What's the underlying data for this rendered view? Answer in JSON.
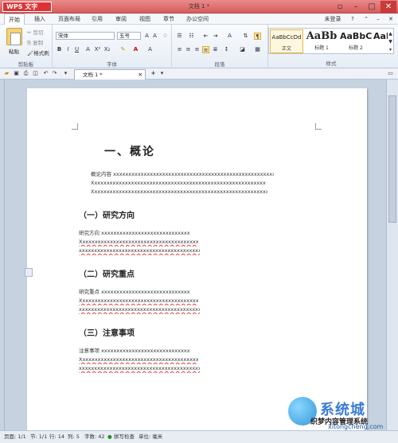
{
  "titlebar": {
    "app_button": "WPS 文字",
    "doc_title": "文档 1 *"
  },
  "menu": [
    "开始",
    "插入",
    "页面布局",
    "引用",
    "审阅",
    "视图",
    "章节",
    "办公空间"
  ],
  "menu_right": "未登录",
  "ribbon": {
    "paste_label": "粘贴",
    "cut_label": "剪切",
    "copy_label": "复制",
    "format_painter_label": "格式刷",
    "font_name": "宋体",
    "font_size": "五号",
    "groups": {
      "clipboard": "剪贴板",
      "font": "字体",
      "paragraph": "段落",
      "styles": "样式"
    },
    "styles": [
      {
        "preview": "AaBbCcDd",
        "name": "正文"
      },
      {
        "preview": "AaBb",
        "name": "标题 1"
      },
      {
        "preview": "AaBbC",
        "name": "标题 2"
      },
      {
        "preview": "AaBbC",
        "name": "标题 3"
      }
    ]
  },
  "tab": {
    "label": "文档 1 *"
  },
  "document": {
    "title": "一、概论",
    "intro": {
      "line1": "概论内容 xxxxxxxxxxxxxxxxxxxxxxxxxxxxxxxxxxxxxxxxxxxxxxxxxxxxxxxxxxxxxxxx",
      "line2": "Xxxxxxxxxxxxxxxxxxxxxxxxxxxxxxxxxxxxxxxxxxxxxxxxxxxxxxxxxxxxxxxxxxxxx",
      "line3": "Xxxxxxxxxxxxxxxxxxxxxxxxxxxxxxxxxxxxxxxxxxxxxxxxxxxxxxxxxxxxxxxxxxxxxxx"
    },
    "sections": [
      {
        "heading": "（一）研究方向",
        "line1": "研究方向 xxxxxxxxxxxxxxxxxxxxxxxxxxxxxxxxx",
        "line2": "Xxxxxxxxxxxxxxxxxxxxxxxxxxxxxxxxxxxxxxxxxxx",
        "line3": "xxxxxxxxxxxxxxxxxxxxxxxxxxxxxxxxxxxxxxxxxxxx"
      },
      {
        "heading": "（二）研究重点",
        "line1": "研究重点 xxxxxxxxxxxxxxxxxxxxxxxxxxxxxxxxx",
        "line2": "Xxxxxxxxxxxxxxxxxxxxxxxxxxxxxxxxxxxxxxxxxxx",
        "line3": "xxxxxxxxxxxxxxxxxxxxxxxxxxxxxxxxxxxxxxxxxxxx"
      },
      {
        "heading": "（三）注意事项",
        "line1": "注意事项 xxxxxxxxxxxxxxxxxxxxxxxxxxxxxxxxx",
        "line2": "Xxxxxxxxxxxxxxxxxxxxxxxxxxxxxxxxxxxxxxxxxxx",
        "line3": "xxxxxxxxxxxxxxxxxxxxxxxxxxxxxxxxxxxxxxxxxxxx"
      }
    ]
  },
  "status": {
    "page": "页面: 1/1",
    "section": "节: 1/1",
    "row": "行: 14",
    "col": "列: 5",
    "words": "字数: 42",
    "spellcheck": "拼写检查",
    "unit": "单位: 毫米"
  },
  "watermark": {
    "brand": "系统城",
    "caption": "织梦内容管理系统",
    "url": "xitongcheng.com"
  }
}
